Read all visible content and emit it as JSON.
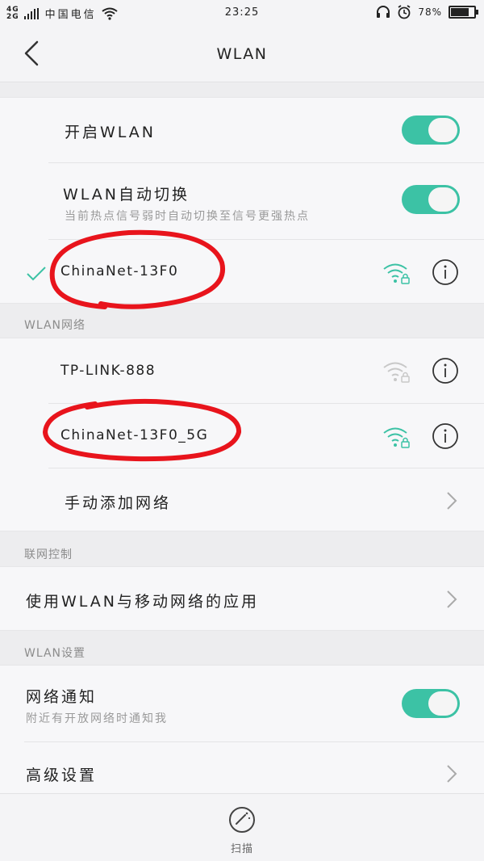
{
  "status_bar": {
    "network_top": "4G",
    "network_bottom": "2G",
    "carrier": "中国电信",
    "time": "23:25",
    "battery": "78%",
    "battery_level": 0.78,
    "icons": [
      "signal-icon",
      "wifi-icon",
      "headset-icon",
      "alarm-icon",
      "battery-icon"
    ]
  },
  "header": {
    "title": "WLAN",
    "back_icon": "chevron-left-icon"
  },
  "toggles": {
    "enable_wlan": {
      "label": "开启WLAN",
      "on": true
    },
    "auto_switch": {
      "label": "WLAN自动切换",
      "description": "当前热点信号弱时自动切换至信号更强热点",
      "on": true
    }
  },
  "connected_network": {
    "ssid": "ChinaNet-13F0",
    "status_icon": "checkmark-icon",
    "signal_icon": "wifi-lock-icon",
    "signal_color": "#3cc2a5"
  },
  "wlan_networks": {
    "section_title": "WLAN网络",
    "items": [
      {
        "ssid": "TP-LINK-888",
        "signal_color": "#c8c8c8"
      },
      {
        "ssid": "ChinaNet-13F0_5G",
        "signal_color": "#3cc2a5"
      }
    ],
    "add_network_label": "手动添加网络"
  },
  "network_control": {
    "section_title": "联网控制",
    "apps_label": "使用WLAN与移动网络的应用"
  },
  "wlan_settings": {
    "section_title": "WLAN设置",
    "notify": {
      "label": "网络通知",
      "description": "附近有开放网络时通知我",
      "on": true
    },
    "advanced_label": "高级设置"
  },
  "bottom_bar": {
    "scan_label": "扫描",
    "scan_icon": "scan-gauge-icon"
  },
  "colors": {
    "accent": "#3cc2a5",
    "annotation_red": "#e8141c"
  }
}
